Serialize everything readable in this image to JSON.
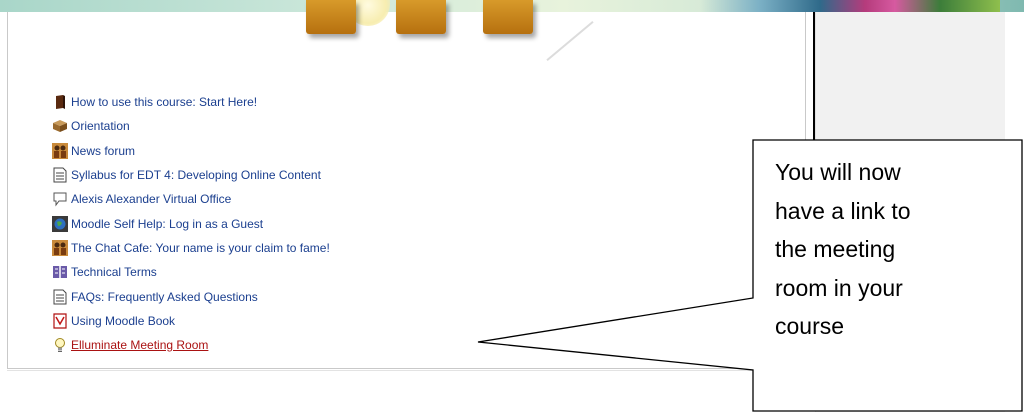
{
  "course_activities": [
    {
      "label": "How to use this course: Start Here!",
      "icon": "book-icon",
      "current": false
    },
    {
      "label": "Orientation",
      "icon": "package-icon",
      "current": false
    },
    {
      "label": "News forum",
      "icon": "forum-icon",
      "current": false
    },
    {
      "label": "Syllabus for EDT 4: Developing Online Content",
      "icon": "document-icon",
      "current": false
    },
    {
      "label": "Alexis Alexander Virtual Office",
      "icon": "speech-bubble-icon",
      "current": false
    },
    {
      "label": "Moodle Self Help: Log in as a Guest",
      "icon": "globe-icon",
      "current": false
    },
    {
      "label": "The Chat Cafe: Your name is your claim to fame!",
      "icon": "forum-icon",
      "current": false
    },
    {
      "label": "Technical Terms",
      "icon": "glossary-icon",
      "current": false
    },
    {
      "label": "FAQs: Frequently Asked Questions",
      "icon": "document-icon",
      "current": false
    },
    {
      "label": "Using Moodle Book",
      "icon": "book-pdf-icon",
      "current": false
    },
    {
      "label": "Elluminate Meeting Room",
      "icon": "lightbulb-icon",
      "current": true
    }
  ],
  "callout": {
    "line1": "You will now",
    "line2": "have a link to",
    "line3": "the meeting",
    "line4": "room in your",
    "line5": "course"
  },
  "colors": {
    "link": "#1b3f8f",
    "current_link": "#aa1212"
  }
}
